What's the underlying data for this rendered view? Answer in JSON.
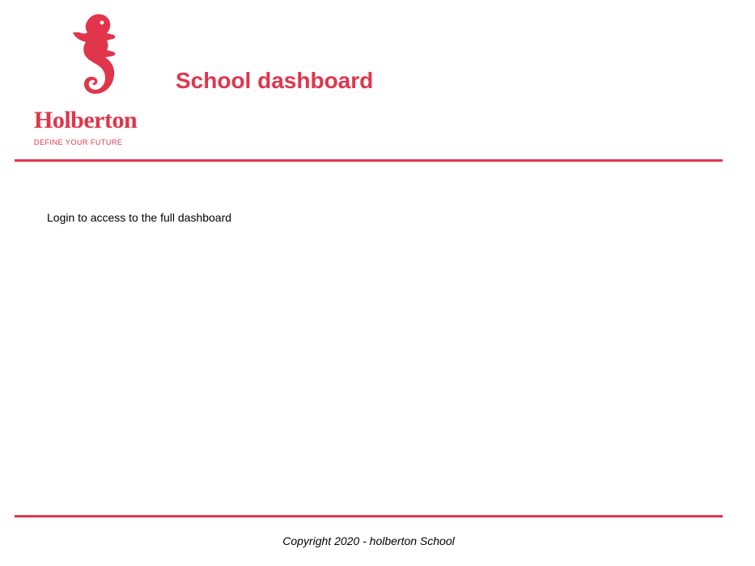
{
  "header": {
    "logo": {
      "wordmark": "Holberton",
      "tagline": "DEFINE YOUR FUTURE",
      "icon": "seahorse-logo-icon"
    },
    "title": "School dashboard"
  },
  "main": {
    "message": "Login to access to the full dashboard"
  },
  "footer": {
    "copyright": "Copyright 2020 - holberton School"
  },
  "colors": {
    "brand": "#e1354b",
    "text": "#000000",
    "background": "#ffffff"
  }
}
